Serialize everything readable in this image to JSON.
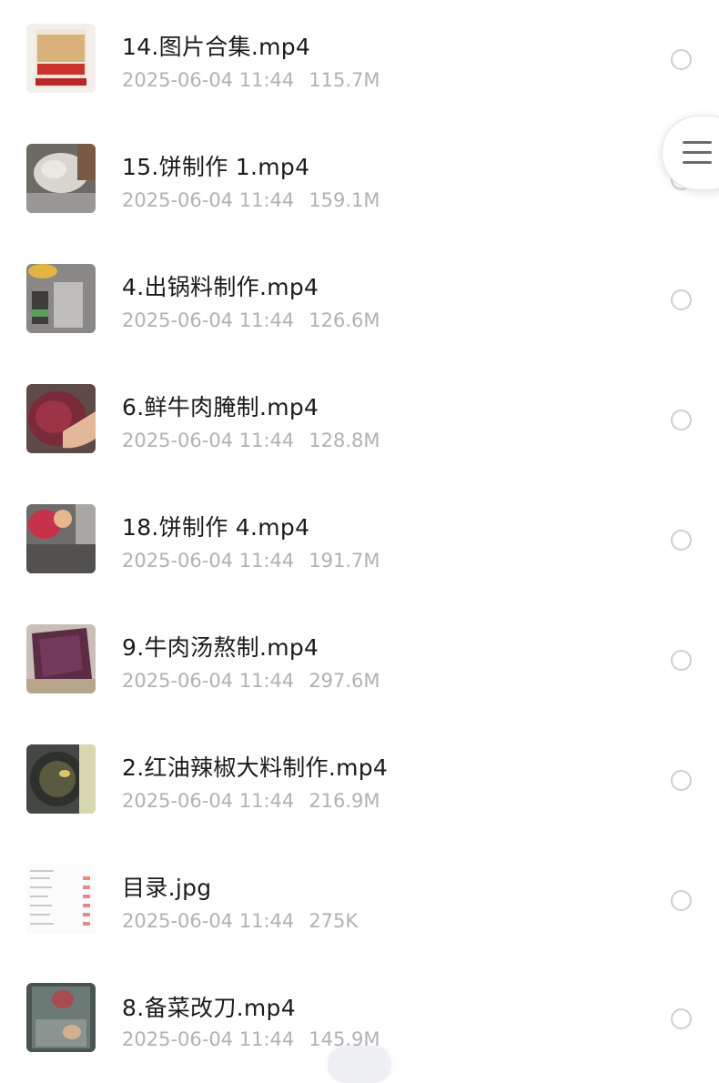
{
  "files": [
    {
      "name": "14.图片合集.mp4",
      "date": "2025-06-04 11:44",
      "size": "115.7M",
      "thumb_icon": "product-box-thumbnail"
    },
    {
      "name": "15.饼制作 1.mp4",
      "date": "2025-06-04 11:44",
      "size": "159.1M",
      "thumb_icon": "dough-thumbnail"
    },
    {
      "name": "4.出锅料制作.mp4",
      "date": "2025-06-04 11:44",
      "size": "126.6M",
      "thumb_icon": "kitchen-pot-thumbnail"
    },
    {
      "name": "6.鲜牛肉腌制.mp4",
      "date": "2025-06-04 11:44",
      "size": "128.8M",
      "thumb_icon": "marinated-beef-thumbnail"
    },
    {
      "name": "18.饼制作 4.mp4",
      "date": "2025-06-04 11:44",
      "size": "191.7M",
      "thumb_icon": "ingredients-thumbnail"
    },
    {
      "name": "9.牛肉汤熬制.mp4",
      "date": "2025-06-04 11:44",
      "size": "297.6M",
      "thumb_icon": "beef-slab-thumbnail"
    },
    {
      "name": "2.红油辣椒大料制作.mp4",
      "date": "2025-06-04 11:44",
      "size": "216.9M",
      "thumb_icon": "oil-wok-thumbnail"
    },
    {
      "name": "目录.jpg",
      "date": "2025-06-04 11:44",
      "size": "275K",
      "thumb_icon": "document-list-thumbnail"
    },
    {
      "name": "8.备菜改刀.mp4",
      "date": "2025-06-04 11:44",
      "size": "145.9M",
      "thumb_icon": "cutting-video-thumbnail"
    }
  ],
  "menu_button": {
    "icon": "hamburger-menu-icon"
  },
  "colors": {
    "title": "#1c1c1c",
    "meta": "#b2b2b5",
    "radio_border": "#cfcfd3"
  }
}
